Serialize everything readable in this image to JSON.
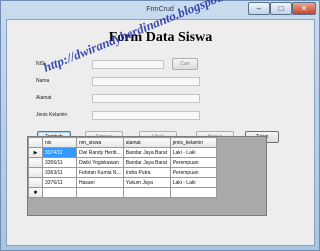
{
  "window": {
    "title": "FrmCrud",
    "min": "–",
    "max": "□",
    "close": "✕"
  },
  "heading": "Form Data Siswa",
  "fields": [
    {
      "label": "NIS",
      "value": ""
    },
    {
      "label": "Nama",
      "value": ""
    },
    {
      "label": "Alamat",
      "value": ""
    },
    {
      "label": "Jenis Kelamin",
      "value": ""
    }
  ],
  "buttons": {
    "cari": "Cari",
    "tambah": "Tambah",
    "simpan": "Simpan",
    "ubah": "Ubah",
    "hapus": "Hapus",
    "tutup": "Tutup"
  },
  "table": {
    "columns": [
      "nis",
      "nm_siswa",
      "alamat",
      "jenis_kelamin"
    ],
    "rows": [
      [
        "3374/11",
        "Dwi Randy Herdi...",
        "Bandar Jaya Barat",
        "Laki - Laki"
      ],
      [
        "3356/11",
        "Dwiki Yogiskawan",
        "Bandar Jaya Barat",
        "Perempuan"
      ],
      [
        "3363/11",
        "Febrian Kumia N...",
        "Indra Putra",
        "Perempuan"
      ],
      [
        "3376/11",
        "Hasani",
        "Yukum Jaya",
        "Laki - Laki"
      ]
    ],
    "row_marker_current": "▶",
    "row_marker_new": "✱"
  },
  "watermark": "http://dwirandyherdinanto.blogspot.com/"
}
